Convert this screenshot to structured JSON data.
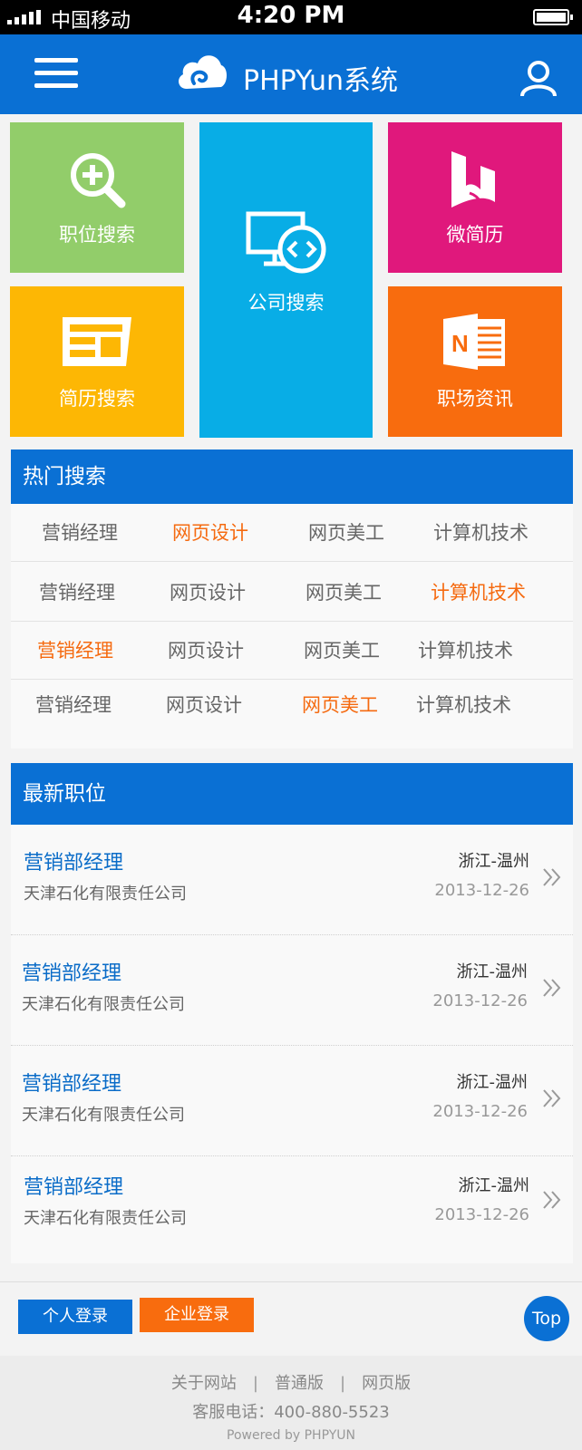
{
  "status": {
    "carrier": "中国移动",
    "time": "4:20 PM"
  },
  "header": {
    "brand": "PHPYun系统"
  },
  "tiles": {
    "job_search": "职位搜索",
    "company_search": "公司搜索",
    "micro_resume": "微简历",
    "resume_search": "简历搜索",
    "career_news": "职场资讯"
  },
  "colors": {
    "primary": "#0a70d4",
    "highlight": "#f56a10",
    "tile_green": "#92cd6a",
    "tile_cyan": "#08ade6",
    "tile_magenta": "#e0187c",
    "tile_yellow": "#fdb704",
    "tile_orange": "#f86c0e"
  },
  "hot": {
    "title": "热门搜索",
    "rows": [
      [
        "营销经理",
        "网页设计",
        "网页美工",
        "计算机技术"
      ],
      [
        "营销经理",
        "网页设计",
        "网页美工",
        "计算机技术"
      ],
      [
        "营销经理",
        "网页设计",
        "网页美工",
        "计算机技术"
      ],
      [
        "营销经理",
        "网页设计",
        "网页美工",
        "计算机技术"
      ]
    ]
  },
  "jobs": {
    "title": "最新职位",
    "items": [
      {
        "title": "营销部经理",
        "company": "天津石化有限责任公司",
        "location": "浙江-温州",
        "date": "2013-12-26"
      },
      {
        "title": "营销部经理",
        "company": "天津石化有限责任公司",
        "location": "浙江-温州",
        "date": "2013-12-26"
      },
      {
        "title": "营销部经理",
        "company": "天津石化有限责任公司",
        "location": "浙江-温州",
        "date": "2013-12-26"
      },
      {
        "title": "营销部经理",
        "company": "天津石化有限责任公司",
        "location": "浙江-温州",
        "date": "2013-12-26"
      }
    ]
  },
  "bottom": {
    "personal_login": "个人登录",
    "company_login": "企业登录",
    "top": "Top"
  },
  "footer": {
    "links": [
      "关于网站",
      "普通版",
      "网页版"
    ],
    "separator": "|",
    "tel": "客服电话：400-880-5523",
    "powered": "Powered by PHPYUN"
  }
}
